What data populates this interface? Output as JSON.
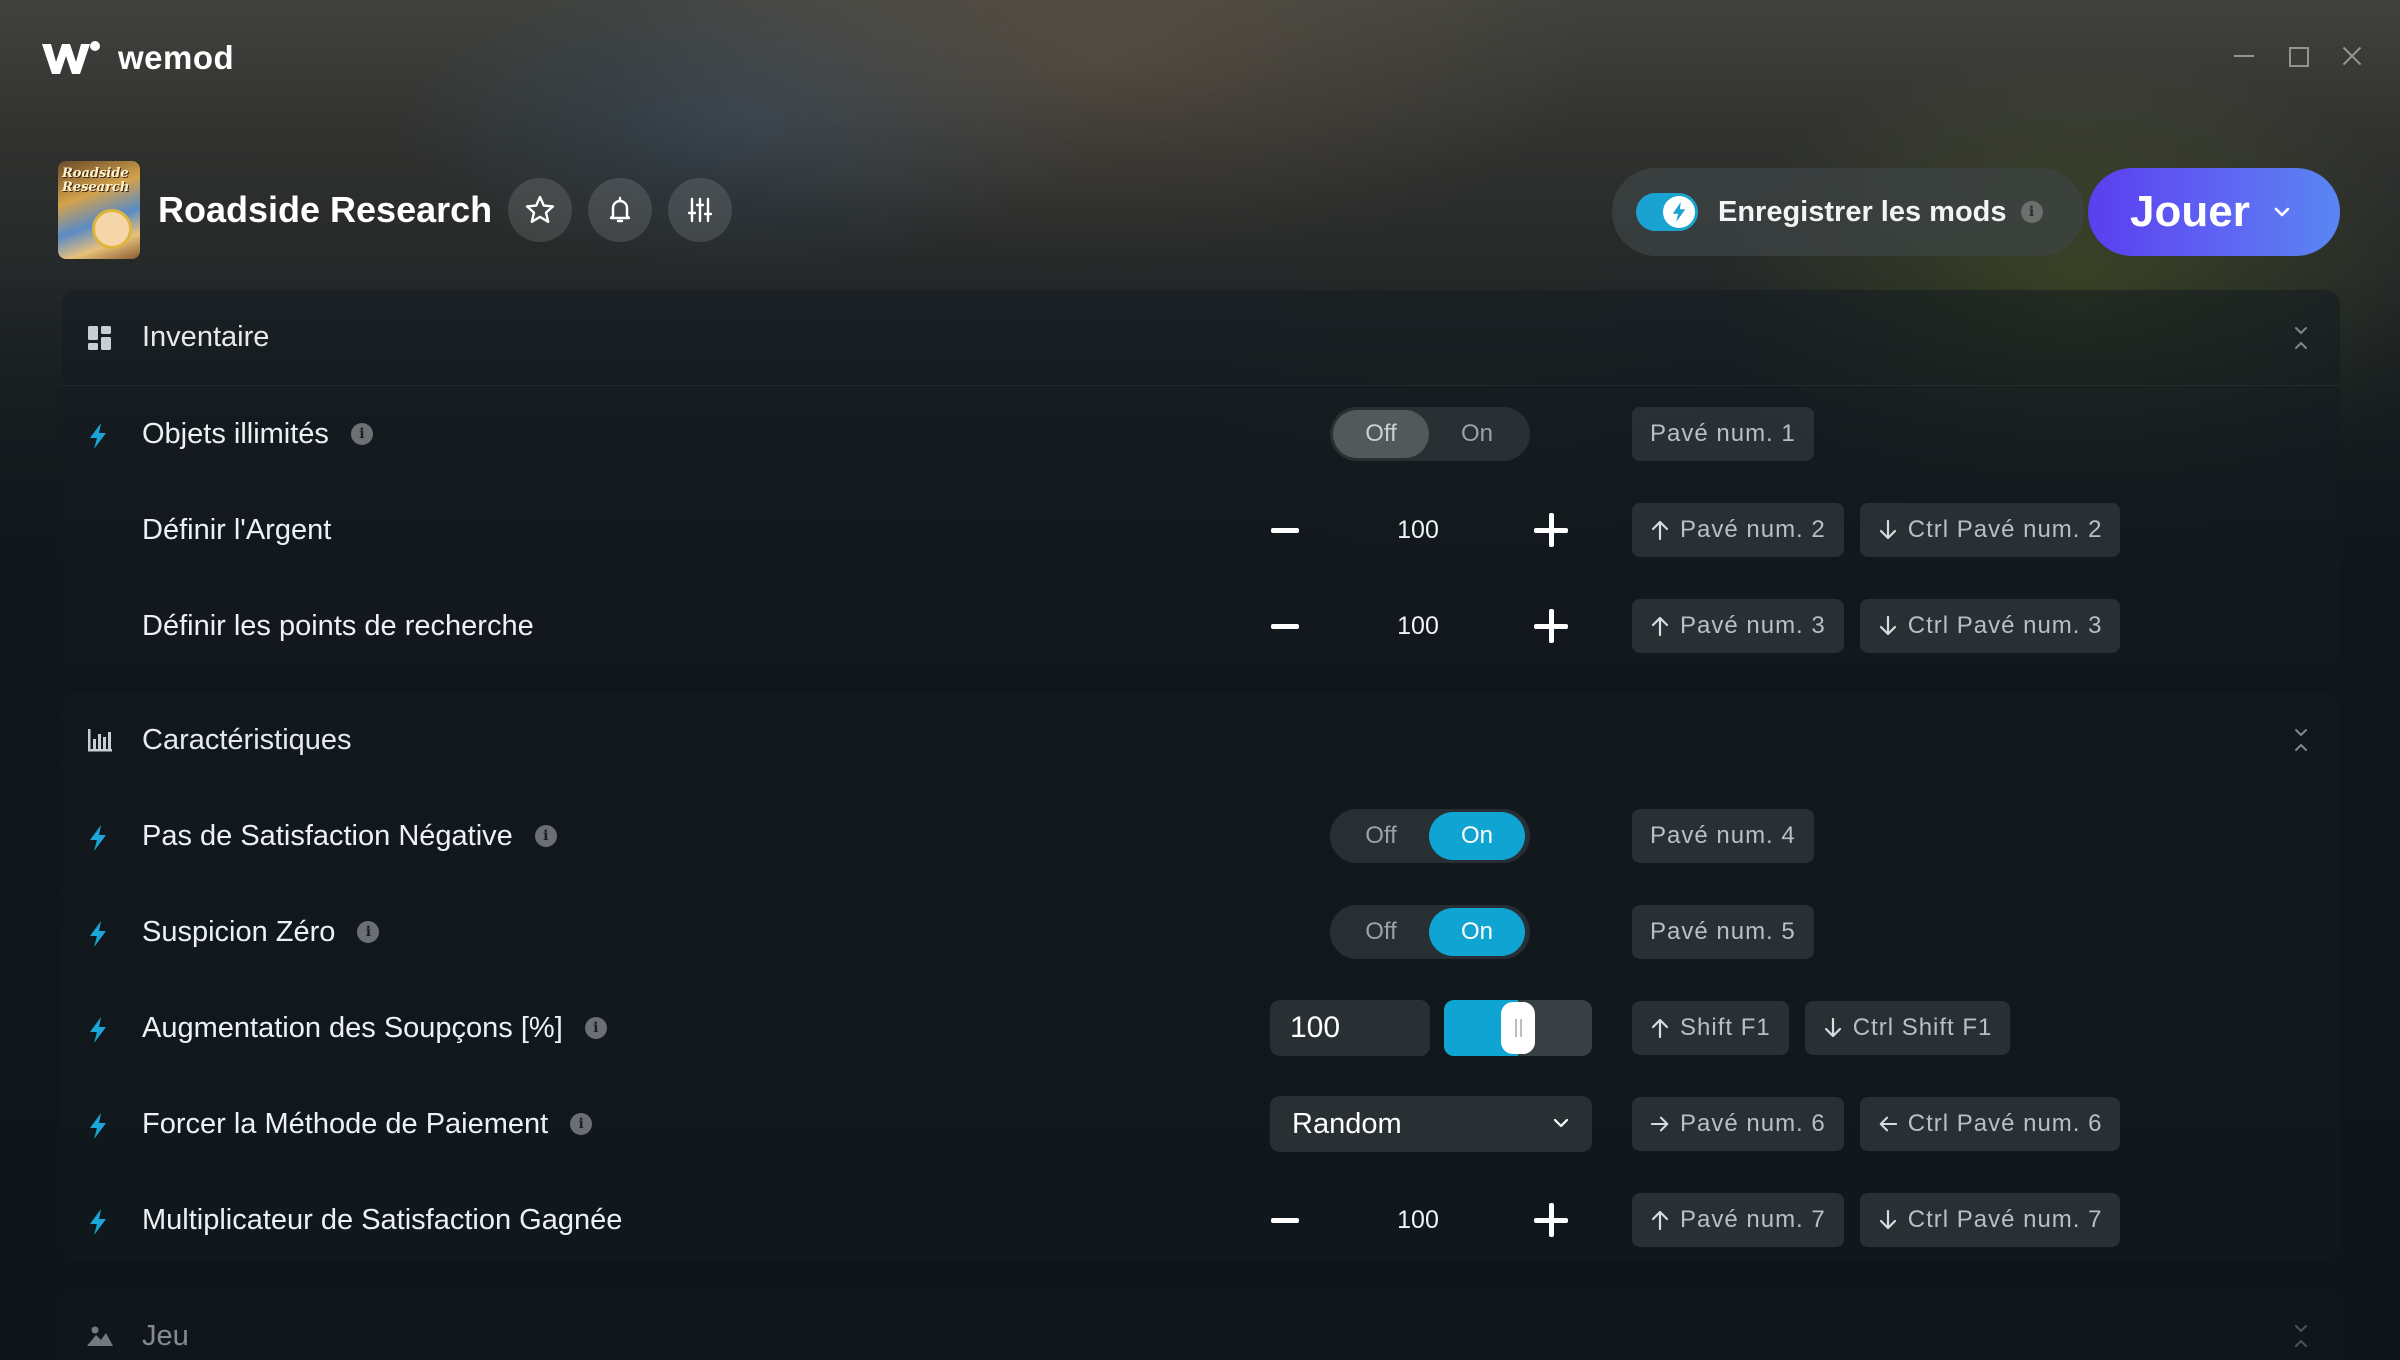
{
  "app": {
    "name": "wemod"
  },
  "game": {
    "title": "Roadside Research",
    "thumb_text": "Roadside Research"
  },
  "header": {
    "save_mods_label": "Enregistrer les mods",
    "info_glyph": "i",
    "play_label": "Jouer"
  },
  "colors": {
    "accent": "#0fa4d2",
    "play_start": "#5b3ef0",
    "play_end": "#5a86f3"
  },
  "sections": [
    {
      "title": "Inventaire",
      "icon": "grid-icon",
      "rows": [
        {
          "label": "Objets illimités",
          "control": "toggle",
          "off": "Off",
          "on": "On",
          "state": "off",
          "keys": [
            {
              "dir": "",
              "text": "Pavé num. 1"
            }
          ]
        },
        {
          "label": "Définir l'Argent",
          "control": "stepper",
          "value": "100",
          "keys": [
            {
              "dir": "up",
              "text": "Pavé num. 2"
            },
            {
              "dir": "down",
              "text": "Ctrl Pavé num. 2"
            }
          ]
        },
        {
          "label": "Définir les points de recherche",
          "control": "stepper",
          "value": "100",
          "keys": [
            {
              "dir": "up",
              "text": "Pavé num. 3"
            },
            {
              "dir": "down",
              "text": "Ctrl Pavé num. 3"
            }
          ]
        }
      ]
    },
    {
      "title": "Caractéristiques",
      "icon": "bar-chart-icon",
      "rows": [
        {
          "label": "Pas de Satisfaction Négative",
          "control": "toggle",
          "off": "Off",
          "on": "On",
          "state": "on",
          "keys": [
            {
              "dir": "",
              "text": "Pavé num. 4"
            }
          ]
        },
        {
          "label": "Suspicion Zéro",
          "control": "toggle",
          "off": "Off",
          "on": "On",
          "state": "on",
          "keys": [
            {
              "dir": "",
              "text": "Pavé num. 5"
            }
          ]
        },
        {
          "label": "Augmentation des Soupçons [%]",
          "control": "slider",
          "value": "100",
          "level": 0.5,
          "keys": [
            {
              "dir": "up",
              "text": "Shift F1"
            },
            {
              "dir": "down",
              "text": "Ctrl Shift F1"
            }
          ]
        },
        {
          "label": "Forcer la Méthode de Paiement",
          "control": "dropdown",
          "value": "Random",
          "keys": [
            {
              "dir": "right",
              "text": "Pavé num. 6"
            },
            {
              "dir": "left",
              "text": "Ctrl Pavé num. 6"
            }
          ]
        },
        {
          "label": "Multiplicateur de Satisfaction Gagnée",
          "control": "stepper",
          "value": "100",
          "keys": [
            {
              "dir": "up",
              "text": "Pavé num. 7"
            },
            {
              "dir": "down",
              "text": "Ctrl Pavé num. 7"
            }
          ]
        }
      ]
    },
    {
      "title": "Jeu",
      "icon": "landscape-icon",
      "rows": []
    }
  ]
}
